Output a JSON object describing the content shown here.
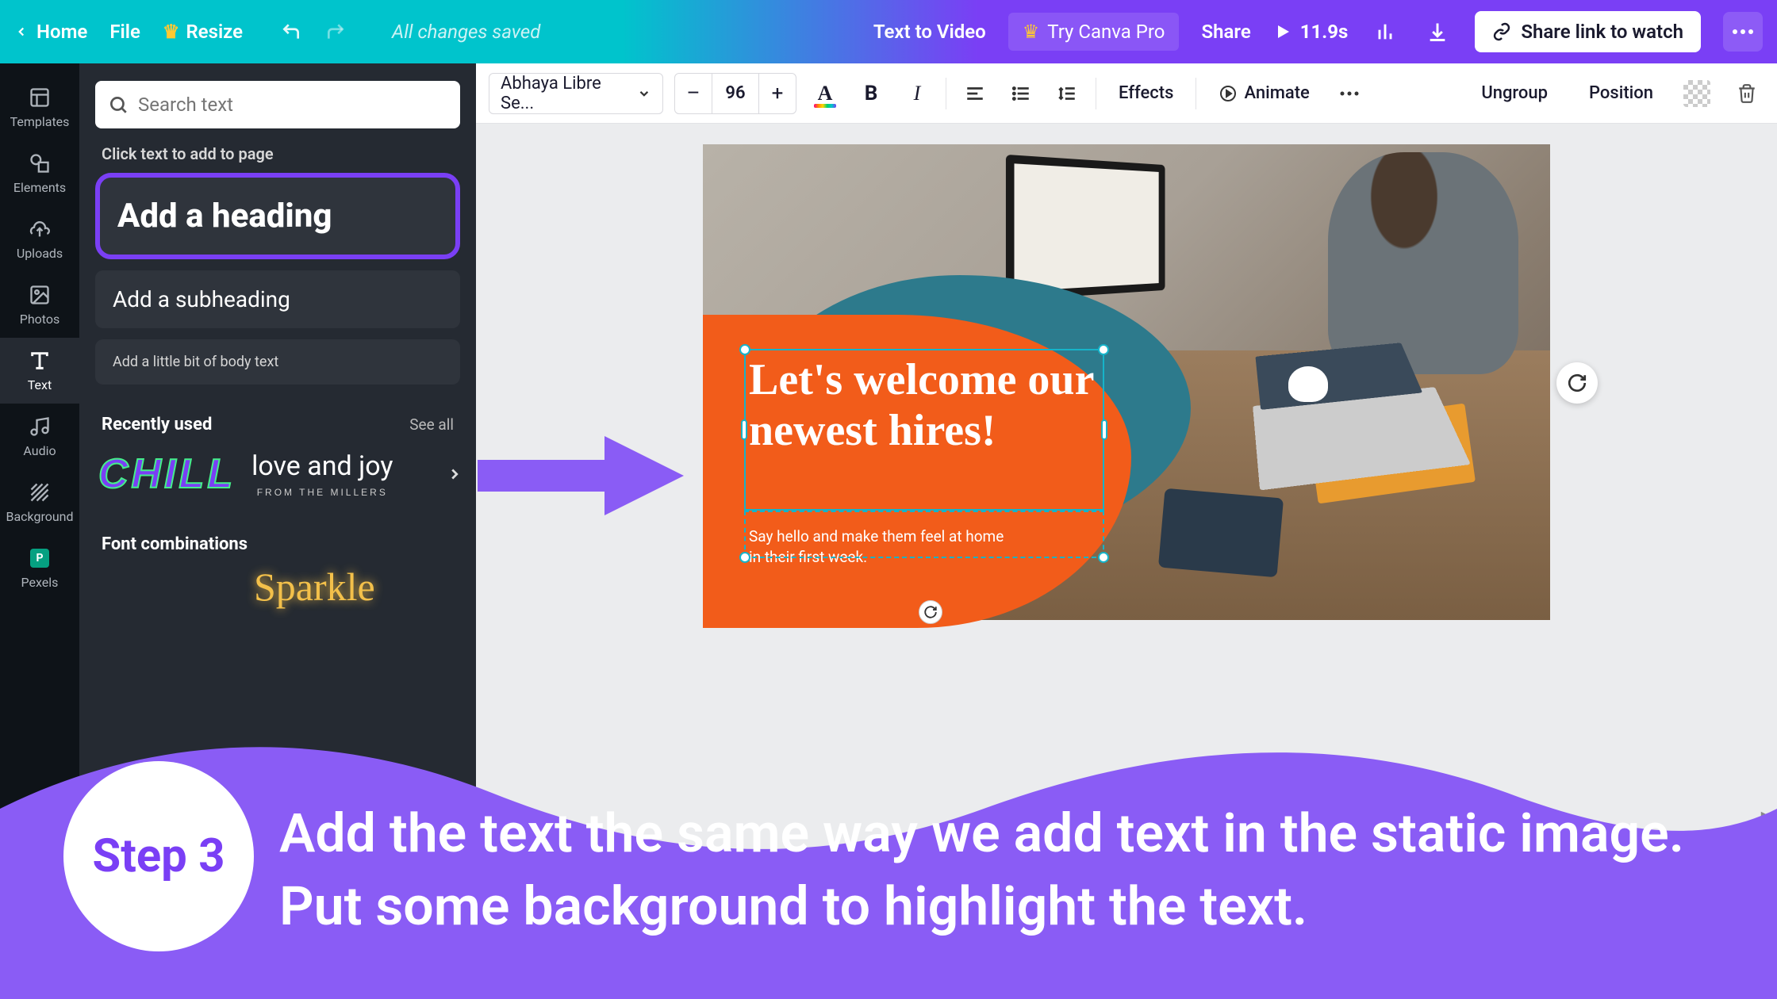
{
  "topbar": {
    "home": "Home",
    "file": "File",
    "resize": "Resize",
    "saved": "All changes saved",
    "text_to_video": "Text to Video",
    "try_pro": "Try Canva Pro",
    "share": "Share",
    "duration": "11.9s",
    "share_link": "Share link to watch"
  },
  "rail": {
    "templates": "Templates",
    "elements": "Elements",
    "uploads": "Uploads",
    "photos": "Photos",
    "text": "Text",
    "audio": "Audio",
    "background": "Background",
    "pexels": "Pexels"
  },
  "panel": {
    "search_placeholder": "Search text",
    "hint": "Click text to add to page",
    "add_heading": "Add a heading",
    "add_sub": "Add a subheading",
    "add_body": "Add a little bit of body text",
    "recently_used": "Recently used",
    "see_all": "See all",
    "sample_chill": "CHILL",
    "sample_lovejoy": "love and joy",
    "sample_lovejoy_sub": "FROM THE MILLERS",
    "font_combos": "Font combinations",
    "sample_sparkle": "Sparkle"
  },
  "ctx": {
    "font_name": "Abhaya Libre Se...",
    "font_size": "96",
    "effects": "Effects",
    "animate": "Animate",
    "ungroup": "Ungroup",
    "position": "Position"
  },
  "design": {
    "headline": "Let's welcome our newest hires!",
    "sub": "Say hello and make them feel at home in their first week."
  },
  "tutorial": {
    "step_label": "Step 3",
    "text": "Add the text the same way we add text in the static image. Put some background to highlight the text."
  }
}
